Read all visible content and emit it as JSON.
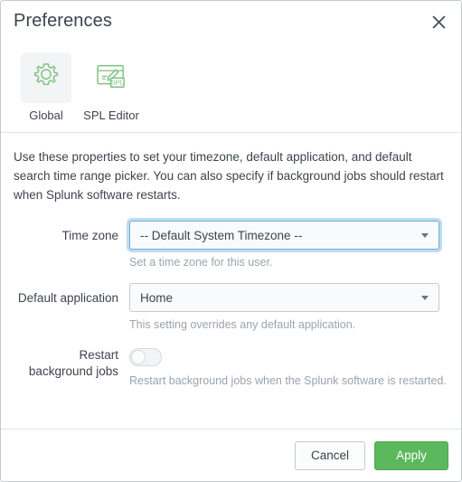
{
  "dialog": {
    "title": "Preferences",
    "close_icon": "close-icon"
  },
  "tabs": [
    {
      "label": "Global",
      "icon": "gear-icon",
      "selected": true
    },
    {
      "label": "SPL Editor",
      "icon": "spl-editor-icon",
      "selected": false
    }
  ],
  "body": {
    "intro": "Use these properties to set your timezone, default application, and default search time range picker. You can also specify if background jobs should restart when Splunk software restarts.",
    "fields": {
      "timezone": {
        "label": "Time zone",
        "value": "-- Default System Timezone --",
        "help": "Set a time zone for this user.",
        "caret_icon": "chevron-down-icon"
      },
      "default_application": {
        "label": "Default application",
        "value": "Home",
        "help": "This setting overrides any default application.",
        "caret_icon": "chevron-down-icon"
      },
      "restart_background_jobs": {
        "label_line1": "Restart",
        "label_line2": "background jobs",
        "state": "off",
        "help": "Restart background jobs when the Splunk software is restarted."
      }
    }
  },
  "footer": {
    "cancel_label": "Cancel",
    "apply_label": "Apply"
  },
  "colors": {
    "accent_green": "#5cb85c",
    "icon_green": "#65a637",
    "focus_blue": "#6db1d6",
    "focus_ring": "#bfdcee",
    "text": "#3c444d",
    "muted_text": "#9aa4ae",
    "border": "#c3cbd4"
  }
}
